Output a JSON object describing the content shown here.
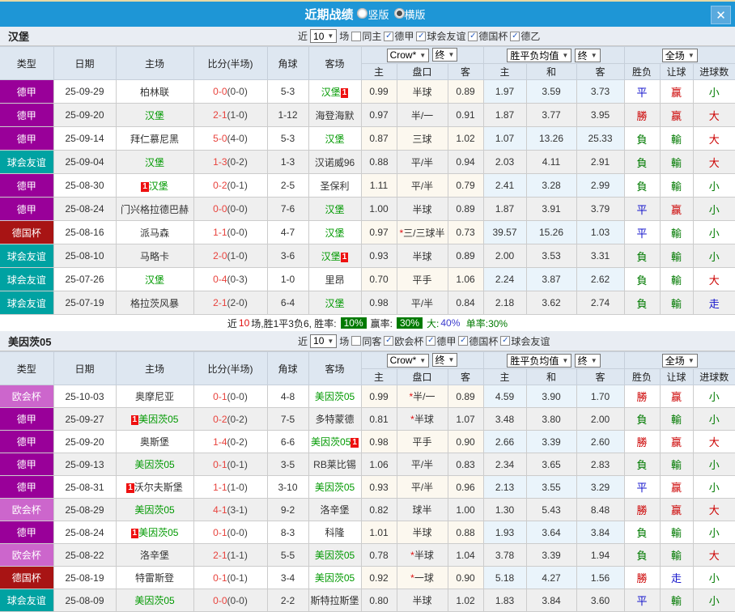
{
  "titlebar": {
    "title": "近期战绩",
    "radios": [
      {
        "label": "竖版",
        "checked": false
      },
      {
        "label": "横版",
        "checked": true
      }
    ],
    "close": "✕"
  },
  "colors": {
    "accent_blue": "#1e96d6",
    "type_colors": {
      "德甲": "#990099",
      "球会友谊": "#00a2a2",
      "德国杯": "#a81414",
      "欧会杯": "#cc66cc"
    },
    "result_colors": {
      "勝": "#cc0000",
      "赢": "#cc0000",
      "大": "#cc0000",
      "負": "#007a00",
      "輸": "#007a00",
      "小": "#007a00",
      "平": "#1515cc",
      "走": "#1515cc"
    },
    "team_green": "#009900",
    "score_red": "#e8423c",
    "badge_red": "#ee1111",
    "summary_badge_green": "#007a00"
  },
  "table_header": {
    "cols": [
      "类型",
      "日期",
      "主场",
      "比分(半场)",
      "角球",
      "客场"
    ],
    "sub": [
      "主",
      "盘口",
      "客",
      "主",
      "和",
      "客",
      "胜负",
      "让球",
      "进球数"
    ],
    "selects": {
      "odds": "Crow*",
      "final1": "终",
      "avg": "胜平负均值",
      "final2": "终",
      "scope": "全场"
    }
  },
  "sections": [
    {
      "team": "汉堡",
      "filter": {
        "near": "近",
        "count": "10",
        "unit": "场",
        "same": {
          "label": "同主",
          "checked": false
        },
        "leagues": [
          {
            "label": "德甲",
            "checked": true
          },
          {
            "label": "球会友谊",
            "checked": true
          },
          {
            "label": "德国杯",
            "checked": true
          },
          {
            "label": "德乙",
            "checked": true
          }
        ]
      },
      "rows": [
        {
          "type": "德甲",
          "date": "25-09-29",
          "home": {
            "name": "柏林联"
          },
          "score": "0-0",
          "half": "(0-0)",
          "corners": "5-3",
          "away": {
            "name": "汉堡",
            "team": true,
            "badge": "after"
          },
          "odds": [
            "0.99",
            "半球",
            "0.89"
          ],
          "avg": [
            "1.97",
            "3.59",
            "3.73"
          ],
          "results": [
            "平",
            "赢",
            "小"
          ]
        },
        {
          "type": "德甲",
          "date": "25-09-20",
          "home": {
            "name": "汉堡",
            "team": true
          },
          "score": "2-1",
          "half": "(1-0)",
          "corners": "1-12",
          "away": {
            "name": "海登海默"
          },
          "odds": [
            "0.97",
            "半/一",
            "0.91"
          ],
          "avg": [
            "1.87",
            "3.77",
            "3.95"
          ],
          "results": [
            "勝",
            "赢",
            "大"
          ]
        },
        {
          "type": "德甲",
          "date": "25-09-14",
          "home": {
            "name": "拜仁慕尼黑"
          },
          "score": "5-0",
          "half": "(4-0)",
          "corners": "5-3",
          "away": {
            "name": "汉堡",
            "team": true
          },
          "odds": [
            "0.87",
            "三球",
            "1.02"
          ],
          "avg": [
            "1.07",
            "13.26",
            "25.33"
          ],
          "results": [
            "負",
            "輸",
            "大"
          ]
        },
        {
          "type": "球会友谊",
          "date": "25-09-04",
          "home": {
            "name": "汉堡",
            "team": true
          },
          "score": "1-3",
          "half": "(0-2)",
          "corners": "1-3",
          "away": {
            "name": "汉诺威96"
          },
          "odds": [
            "0.88",
            "平/半",
            "0.94"
          ],
          "avg": [
            "2.03",
            "4.11",
            "2.91"
          ],
          "results": [
            "負",
            "輸",
            "大"
          ]
        },
        {
          "type": "德甲",
          "date": "25-08-30",
          "home": {
            "name": "汉堡",
            "team": true,
            "badge": "before"
          },
          "score": "0-2",
          "half": "(0-1)",
          "corners": "2-5",
          "away": {
            "name": "圣保利"
          },
          "odds": [
            "1.11",
            "平/半",
            "0.79"
          ],
          "avg": [
            "2.41",
            "3.28",
            "2.99"
          ],
          "results": [
            "負",
            "輸",
            "小"
          ]
        },
        {
          "type": "德甲",
          "date": "25-08-24",
          "home": {
            "name": "门兴格拉德巴赫"
          },
          "score": "0-0",
          "half": "(0-0)",
          "corners": "7-6",
          "away": {
            "name": "汉堡",
            "team": true
          },
          "odds": [
            "1.00",
            "半球",
            "0.89"
          ],
          "avg": [
            "1.87",
            "3.91",
            "3.79"
          ],
          "results": [
            "平",
            "赢",
            "小"
          ]
        },
        {
          "type": "德国杯",
          "date": "25-08-16",
          "home": {
            "name": "派马森"
          },
          "score": "1-1",
          "half": "(0-0)",
          "corners": "4-7",
          "away": {
            "name": "汉堡",
            "team": true
          },
          "odds": [
            "0.97",
            "*三/三球半",
            "0.73"
          ],
          "avg": [
            "39.57",
            "15.26",
            "1.03"
          ],
          "results": [
            "平",
            "輸",
            "小"
          ]
        },
        {
          "type": "球会友谊",
          "date": "25-08-10",
          "home": {
            "name": "马略卡"
          },
          "score": "2-0",
          "half": "(1-0)",
          "corners": "3-6",
          "away": {
            "name": "汉堡",
            "team": true,
            "badge": "after"
          },
          "odds": [
            "0.93",
            "半球",
            "0.89"
          ],
          "avg": [
            "2.00",
            "3.53",
            "3.31"
          ],
          "results": [
            "負",
            "輸",
            "小"
          ]
        },
        {
          "type": "球会友谊",
          "date": "25-07-26",
          "home": {
            "name": "汉堡",
            "team": true
          },
          "score": "0-4",
          "half": "(0-3)",
          "corners": "1-0",
          "away": {
            "name": "里昂"
          },
          "odds": [
            "0.70",
            "平手",
            "1.06"
          ],
          "avg": [
            "2.24",
            "3.87",
            "2.62"
          ],
          "results": [
            "負",
            "輸",
            "大"
          ]
        },
        {
          "type": "球会友谊",
          "date": "25-07-19",
          "home": {
            "name": "格拉茨风暴"
          },
          "score": "2-1",
          "half": "(2-0)",
          "corners": "6-4",
          "away": {
            "name": "汉堡",
            "team": true
          },
          "odds": [
            "0.98",
            "平/半",
            "0.84"
          ],
          "avg": [
            "2.18",
            "3.62",
            "2.74"
          ],
          "results": [
            "負",
            "輸",
            "走"
          ]
        }
      ],
      "summary": {
        "near": "近",
        "num": "10",
        "rest": "场,胜1平3负6, 胜率:",
        "rate1": "10%",
        "label2": "赢率:",
        "rate2": "30%",
        "big_label": "大:",
        "big_value": "40%",
        "odd_text": "单率:30%"
      }
    },
    {
      "team": "美因茨05",
      "filter": {
        "near": "近",
        "count": "10",
        "unit": "场",
        "same": {
          "label": "同客",
          "checked": false
        },
        "leagues": [
          {
            "label": "欧会杯",
            "checked": true
          },
          {
            "label": "德甲",
            "checked": true
          },
          {
            "label": "德国杯",
            "checked": true
          },
          {
            "label": "球会友谊",
            "checked": true
          }
        ]
      },
      "rows": [
        {
          "type": "欧会杯",
          "date": "25-10-03",
          "home": {
            "name": "奥摩尼亚"
          },
          "score": "0-1",
          "half": "(0-0)",
          "corners": "4-8",
          "away": {
            "name": "美因茨05",
            "team": true
          },
          "odds": [
            "0.99",
            "*半/一",
            "0.89"
          ],
          "avg": [
            "4.59",
            "3.90",
            "1.70"
          ],
          "results": [
            "勝",
            "赢",
            "小"
          ]
        },
        {
          "type": "德甲",
          "date": "25-09-27",
          "home": {
            "name": "美因茨05",
            "team": true,
            "badge": "before"
          },
          "score": "0-2",
          "half": "(0-2)",
          "corners": "7-5",
          "away": {
            "name": "多特蒙德"
          },
          "odds": [
            "0.81",
            "*半球",
            "1.07"
          ],
          "avg": [
            "3.48",
            "3.80",
            "2.00"
          ],
          "results": [
            "負",
            "輸",
            "小"
          ]
        },
        {
          "type": "德甲",
          "date": "25-09-20",
          "home": {
            "name": "奥斯堡"
          },
          "score": "1-4",
          "half": "(0-2)",
          "corners": "6-6",
          "away": {
            "name": "美因茨05",
            "team": true,
            "badge": "after"
          },
          "odds": [
            "0.98",
            "平手",
            "0.90"
          ],
          "avg": [
            "2.66",
            "3.39",
            "2.60"
          ],
          "results": [
            "勝",
            "赢",
            "大"
          ]
        },
        {
          "type": "德甲",
          "date": "25-09-13",
          "home": {
            "name": "美因茨05",
            "team": true
          },
          "score": "0-1",
          "half": "(0-1)",
          "corners": "3-5",
          "away": {
            "name": "RB莱比锡"
          },
          "odds": [
            "1.06",
            "平/半",
            "0.83"
          ],
          "avg": [
            "2.34",
            "3.65",
            "2.83"
          ],
          "results": [
            "負",
            "輸",
            "小"
          ]
        },
        {
          "type": "德甲",
          "date": "25-08-31",
          "home": {
            "name": "沃尔夫斯堡",
            "badge": "before"
          },
          "score": "1-1",
          "half": "(1-0)",
          "corners": "3-10",
          "away": {
            "name": "美因茨05",
            "team": true
          },
          "odds": [
            "0.93",
            "平/半",
            "0.96"
          ],
          "avg": [
            "2.13",
            "3.55",
            "3.29"
          ],
          "results": [
            "平",
            "赢",
            "小"
          ]
        },
        {
          "type": "欧会杯",
          "date": "25-08-29",
          "home": {
            "name": "美因茨05",
            "team": true
          },
          "score": "4-1",
          "half": "(3-1)",
          "corners": "9-2",
          "away": {
            "name": "洛辛堡"
          },
          "odds": [
            "0.82",
            "球半",
            "1.00"
          ],
          "avg": [
            "1.30",
            "5.43",
            "8.48"
          ],
          "results": [
            "勝",
            "赢",
            "大"
          ]
        },
        {
          "type": "德甲",
          "date": "25-08-24",
          "home": {
            "name": "美因茨05",
            "team": true,
            "badge": "before"
          },
          "score": "0-1",
          "half": "(0-0)",
          "corners": "8-3",
          "away": {
            "name": "科隆"
          },
          "odds": [
            "1.01",
            "半球",
            "0.88"
          ],
          "avg": [
            "1.93",
            "3.64",
            "3.84"
          ],
          "results": [
            "負",
            "輸",
            "小"
          ]
        },
        {
          "type": "欧会杯",
          "date": "25-08-22",
          "home": {
            "name": "洛辛堡"
          },
          "score": "2-1",
          "half": "(1-1)",
          "corners": "5-5",
          "away": {
            "name": "美因茨05",
            "team": true
          },
          "odds": [
            "0.78",
            "*半球",
            "1.04"
          ],
          "avg": [
            "3.78",
            "3.39",
            "1.94"
          ],
          "results": [
            "負",
            "輸",
            "大"
          ]
        },
        {
          "type": "德国杯",
          "date": "25-08-19",
          "home": {
            "name": "特雷斯登"
          },
          "score": "0-1",
          "half": "(0-1)",
          "corners": "3-4",
          "away": {
            "name": "美因茨05",
            "team": true
          },
          "odds": [
            "0.92",
            "*一球",
            "0.90"
          ],
          "avg": [
            "5.18",
            "4.27",
            "1.56"
          ],
          "results": [
            "勝",
            "走",
            "小"
          ]
        },
        {
          "type": "球会友谊",
          "date": "25-08-09",
          "home": {
            "name": "美因茨05",
            "team": true
          },
          "score": "0-0",
          "half": "(0-0)",
          "corners": "2-2",
          "away": {
            "name": "斯特拉斯堡"
          },
          "odds": [
            "0.80",
            "半球",
            "1.02"
          ],
          "avg": [
            "1.83",
            "3.84",
            "3.60"
          ],
          "results": [
            "平",
            "輸",
            "小"
          ]
        }
      ]
    }
  ]
}
